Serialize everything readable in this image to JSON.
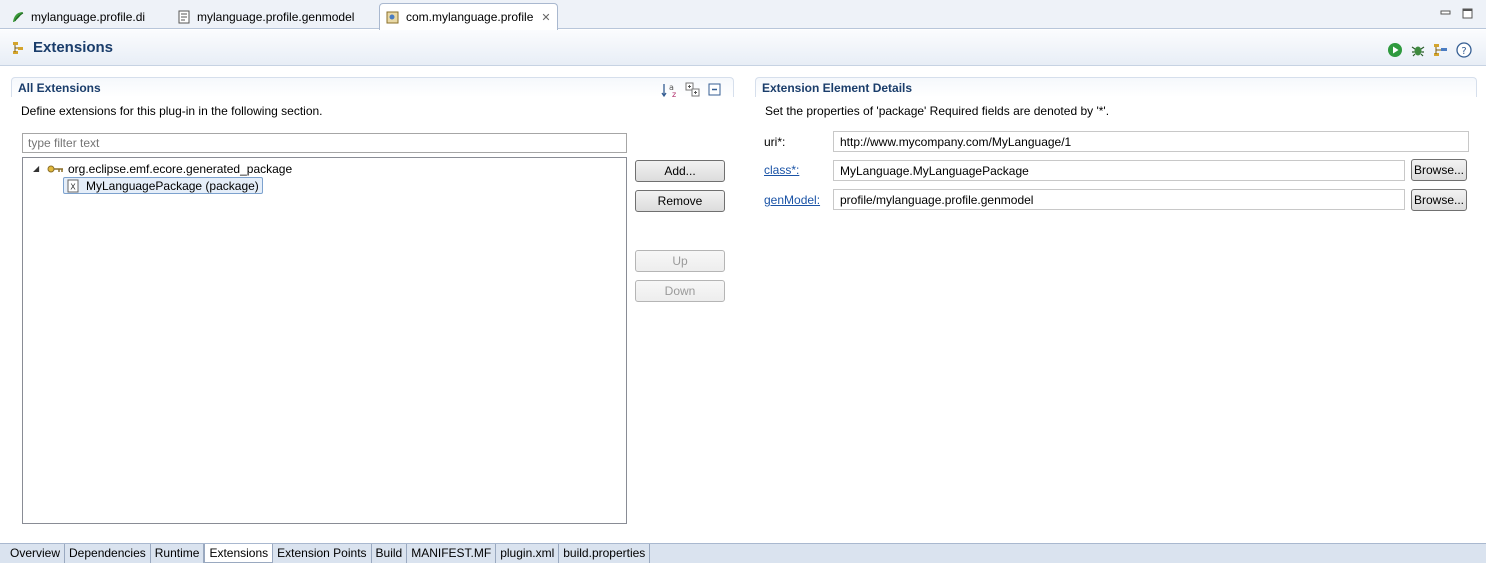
{
  "editor_tabs": [
    {
      "label": "mylanguage.profile.di",
      "icon": "papyrus-diagram-icon"
    },
    {
      "label": "mylanguage.profile.genmodel",
      "icon": "genmodel-file-icon"
    },
    {
      "label": "com.mylanguage.profile",
      "icon": "plugin-manifest-icon",
      "active": true
    }
  ],
  "form": {
    "title": "Extensions"
  },
  "all_extensions": {
    "title": "All Extensions",
    "description": "Define extensions for this plug-in in the following section.",
    "filter_placeholder": "type filter text",
    "tree": {
      "root": "org.eclipse.emf.ecore.generated_package",
      "child": "MyLanguagePackage (package)"
    },
    "buttons": {
      "add": "Add...",
      "remove": "Remove",
      "up": "Up",
      "down": "Down"
    }
  },
  "details": {
    "title": "Extension Element Details",
    "description": "Set the properties of 'package' Required fields are denoted by '*'.",
    "uri_label": "uri*:",
    "uri_value": "http://www.mycompany.com/MyLanguage/1",
    "class_label": "class*:",
    "class_value": "MyLanguage.MyLanguagePackage",
    "genmodel_label": "genModel:",
    "genmodel_value": "profile/mylanguage.profile.genmodel",
    "browse_label": "Browse..."
  },
  "page_tabs": [
    "Overview",
    "Dependencies",
    "Runtime",
    "Extensions",
    "Extension Points",
    "Build",
    "MANIFEST.MF",
    "plugin.xml",
    "build.properties"
  ],
  "active_page_tab": "Extensions"
}
